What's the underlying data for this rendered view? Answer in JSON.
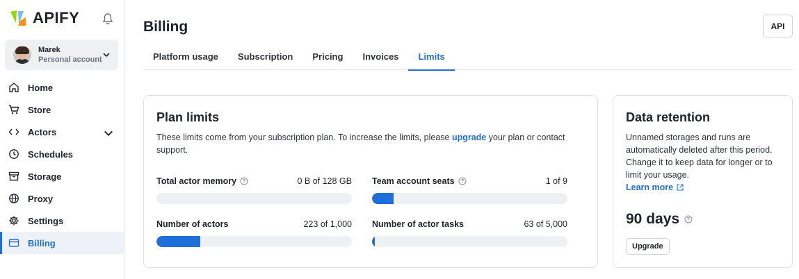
{
  "brand": {
    "name": "APIFY"
  },
  "account": {
    "name": "Marek",
    "type": "Personal account"
  },
  "sidebar": {
    "items": [
      {
        "label": "Home",
        "icon": "home-icon"
      },
      {
        "label": "Store",
        "icon": "cart-icon"
      },
      {
        "label": "Actors",
        "icon": "code-icon"
      },
      {
        "label": "Schedules",
        "icon": "clock-icon"
      },
      {
        "label": "Storage",
        "icon": "archive-icon"
      },
      {
        "label": "Proxy",
        "icon": "globe-icon"
      },
      {
        "label": "Settings",
        "icon": "gear-icon"
      },
      {
        "label": "Billing",
        "icon": "card-icon",
        "active": true
      }
    ]
  },
  "header": {
    "title": "Billing",
    "api_label": "API"
  },
  "tabs": [
    {
      "label": "Platform usage"
    },
    {
      "label": "Subscription"
    },
    {
      "label": "Pricing"
    },
    {
      "label": "Invoices"
    },
    {
      "label": "Limits",
      "active": true
    }
  ],
  "plan_limits": {
    "title": "Plan limits",
    "desc_before": "These limits come from your subscription plan. To increase the limits, please ",
    "desc_link": "upgrade",
    "desc_after": " your plan or contact support.",
    "limits": [
      {
        "label": "Total actor memory",
        "value": "0 B of 128 GB",
        "fraction": 0.0,
        "help": true
      },
      {
        "label": "Team account seats",
        "value": "1 of 9",
        "fraction": 0.111,
        "help": true
      },
      {
        "label": "Number of actors",
        "value": "223 of 1,000",
        "fraction": 0.223,
        "help": false
      },
      {
        "label": "Number of actor tasks",
        "value": "63 of 5,000",
        "fraction": 0.0126,
        "help": false
      }
    ]
  },
  "retention": {
    "title": "Data retention",
    "desc": "Unnamed storages and runs are automatically deleted after this period. Change it to keep data for longer or to limit your usage.",
    "link": "Learn more",
    "value": "90 days",
    "button": "Upgrade"
  },
  "colors": {
    "accent": "#1e6fd9",
    "bar_track": "#eef0f3",
    "border": "#dfe2e6"
  }
}
